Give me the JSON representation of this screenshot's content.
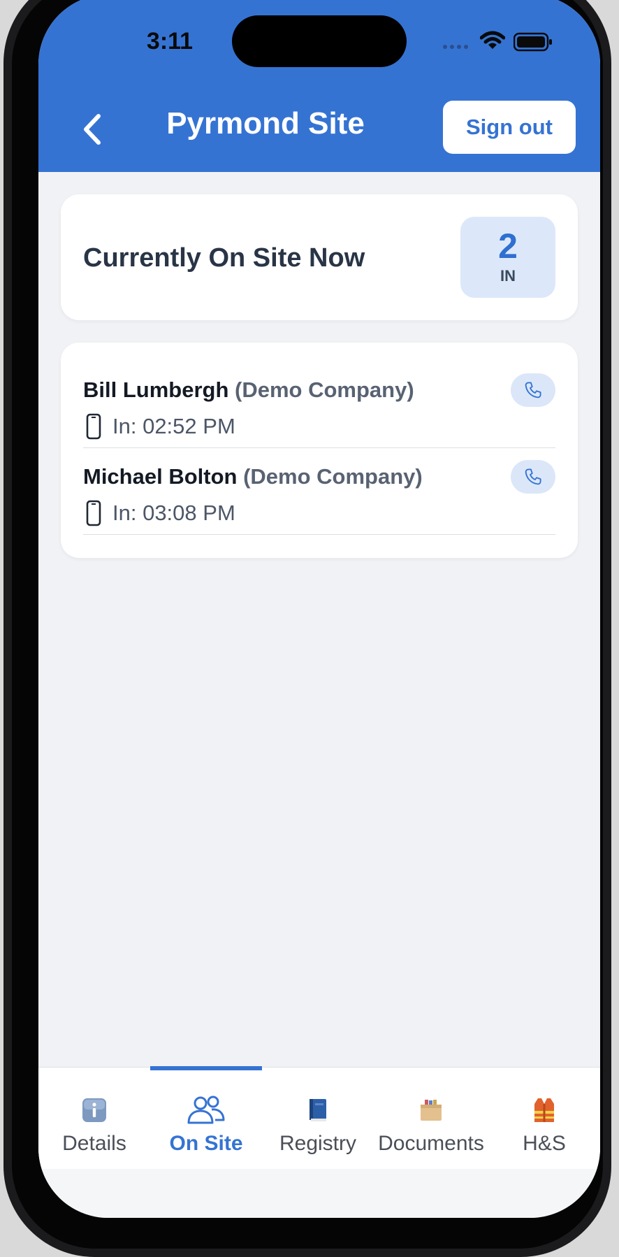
{
  "status_bar": {
    "time": "3:11"
  },
  "header": {
    "title": "Pyrmond Site",
    "sign_out_label": "Sign out",
    "back_icon": "chevron-left-icon"
  },
  "summary": {
    "title": "Currently On Site Now",
    "count": "2",
    "count_unit": "IN"
  },
  "people": [
    {
      "name": "Bill Lumbergh",
      "company": "(Demo Company)",
      "time": "In: 02:52 PM"
    },
    {
      "name": "Michael Bolton",
      "company": "(Demo Company)",
      "time": "In: 03:08 PM"
    }
  ],
  "tabs": [
    {
      "label": "Details",
      "icon": "info-icon"
    },
    {
      "label": "On Site",
      "icon": "people-icon",
      "active": true
    },
    {
      "label": "Registry",
      "icon": "book-icon"
    },
    {
      "label": "Documents",
      "icon": "box-icon"
    },
    {
      "label": "H&S",
      "icon": "safety-vest-icon"
    }
  ],
  "colors": {
    "accent": "#3573d3",
    "background": "#f1f2f6",
    "badge_bg": "#dce8fa"
  }
}
